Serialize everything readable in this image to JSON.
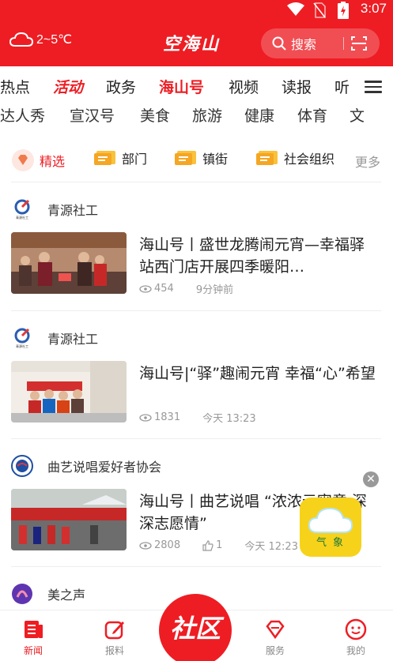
{
  "status": {
    "time": "3:07"
  },
  "header": {
    "weather": "2~5℃",
    "logo": "空海山",
    "search_label": "搜索"
  },
  "tabs_row1": [
    {
      "label": "热点",
      "state": "normal"
    },
    {
      "label": "活动",
      "state": "active"
    },
    {
      "label": "政务",
      "state": "normal"
    },
    {
      "label": "海山号",
      "state": "highlight"
    },
    {
      "label": "视频",
      "state": "normal"
    },
    {
      "label": "读报",
      "state": "normal"
    },
    {
      "label": "听",
      "state": "normal"
    }
  ],
  "tabs_row2": [
    "达人秀",
    "宣汉号",
    "美食",
    "旅游",
    "健康",
    "体育",
    "文"
  ],
  "categories": [
    {
      "label": "精选",
      "icon": "diamond-icon",
      "selected": true
    },
    {
      "label": "部门",
      "icon": "ticket-icon",
      "selected": false
    },
    {
      "label": "镇街",
      "icon": "ticket-icon",
      "selected": false
    },
    {
      "label": "社会组织",
      "icon": "ticket-icon",
      "selected": false
    }
  ],
  "more_label": "更多",
  "feed": [
    {
      "source": "青源社工",
      "avatar_text": "青源社工",
      "title": "海山号丨盛世龙腾闹元宵—幸福驿站西门店开展四季暖阳…",
      "views": "454",
      "likes": "",
      "time": "9分钟前"
    },
    {
      "source": "青源社工",
      "avatar_text": "青源社工",
      "title": "海山号|“驿”趣闹元宵 幸福“心”希望",
      "views": "1831",
      "likes": "",
      "time": "今天 13:23"
    },
    {
      "source": "曲艺说唱爱好者协会",
      "avatar_text": "",
      "title": "海山号丨曲艺说唱 “浓浓元宵意 深深志愿情”",
      "views": "2808",
      "likes": "1",
      "time": "今天 12:23"
    },
    {
      "source": "美之声",
      "avatar_text": "",
      "title": "",
      "views": "",
      "likes": "",
      "time": ""
    }
  ],
  "float_weather": {
    "label": "气象"
  },
  "bottom_nav": {
    "news": "新闻",
    "report": "报料",
    "center": "社区",
    "service": "服务",
    "mine": "我的"
  },
  "colors": {
    "brand": "#ee1d23",
    "float": "#f7d21a"
  }
}
